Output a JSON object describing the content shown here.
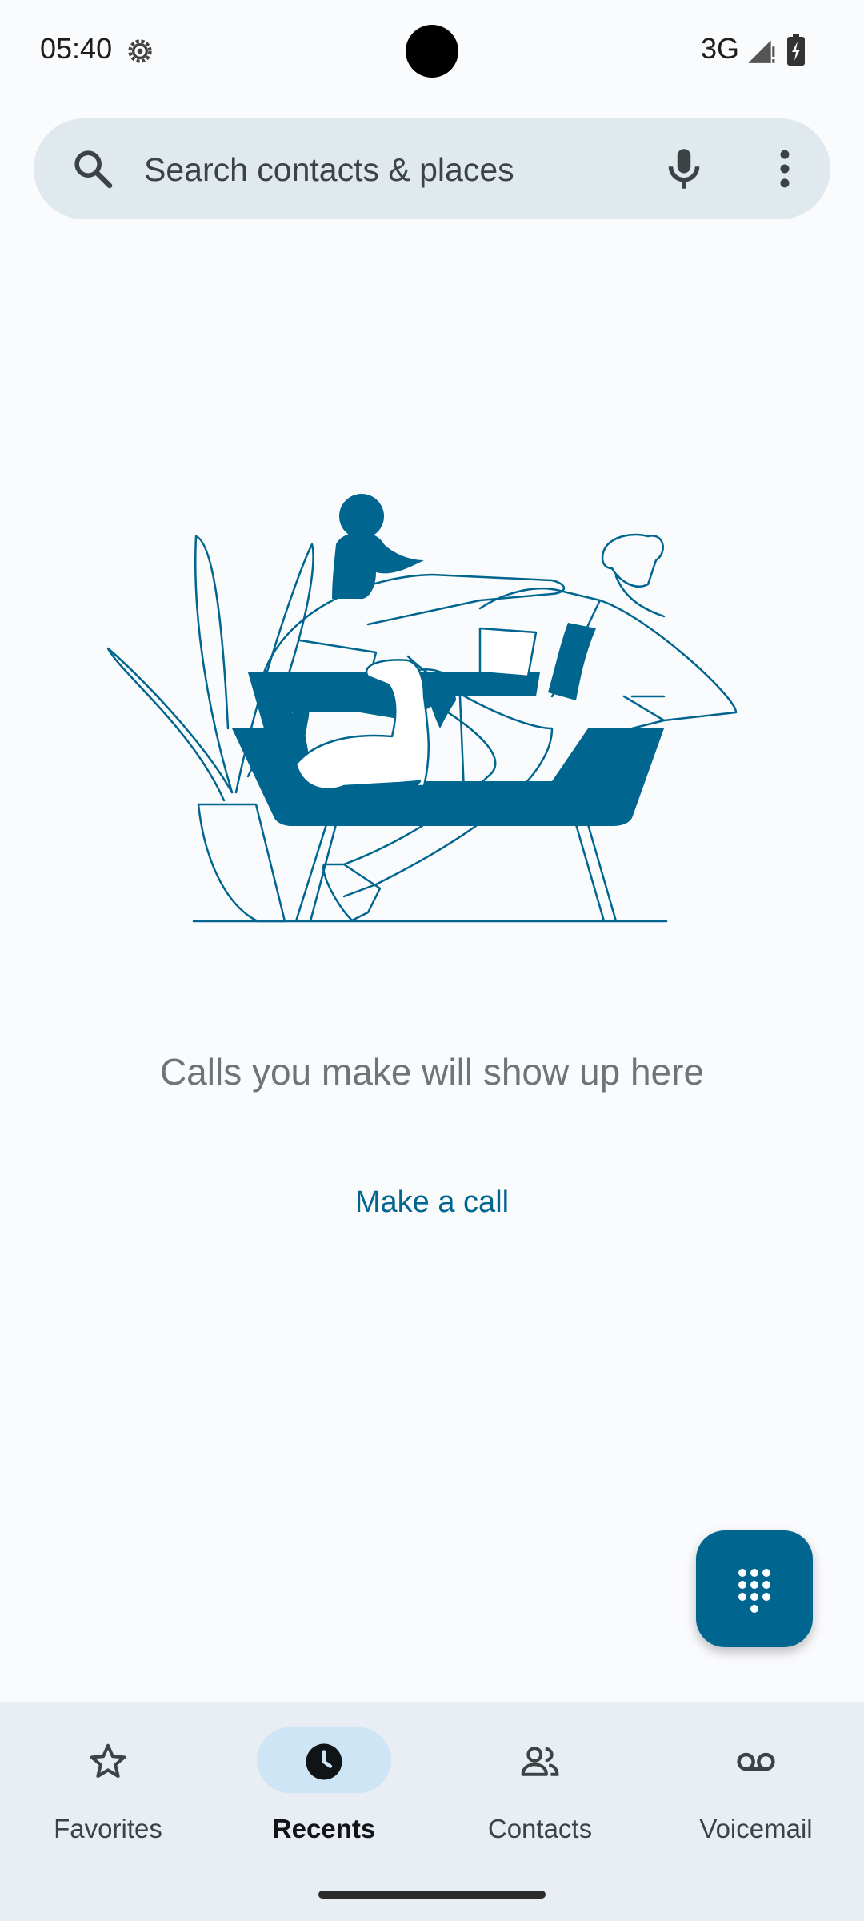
{
  "status_bar": {
    "time": "05:40",
    "network": "3G",
    "icons": [
      "settings-gear-icon",
      "signal-icon",
      "battery-charging-icon"
    ]
  },
  "search": {
    "placeholder": "Search contacts & places",
    "icons": [
      "search-icon",
      "mic-icon",
      "more-vert-icon"
    ]
  },
  "empty_state": {
    "message": "Calls you make will show up here",
    "action_label": "Make a call"
  },
  "fab": {
    "icon": "dialpad-icon"
  },
  "bottom_nav": {
    "items": [
      {
        "label": "Favorites",
        "icon": "star-icon",
        "active": false
      },
      {
        "label": "Recents",
        "icon": "clock-icon",
        "active": true
      },
      {
        "label": "Contacts",
        "icon": "people-icon",
        "active": false
      },
      {
        "label": "Voicemail",
        "icon": "voicemail-icon",
        "active": false
      }
    ]
  },
  "colors": {
    "accent": "#00658f",
    "search_bg": "#dfe9ee",
    "nav_bg": "#e8eef3",
    "active_pill": "#cde5f4",
    "page_bg": "#fafbfd"
  }
}
